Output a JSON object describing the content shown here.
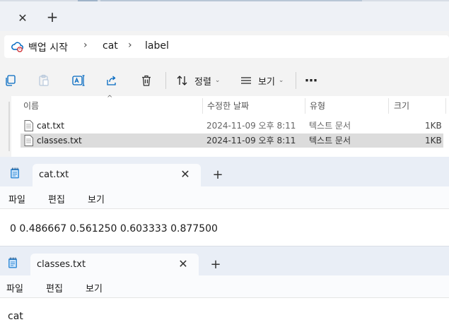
{
  "explorer": {
    "tab_close_glyph": "✕",
    "new_tab_glyph": "+",
    "breadcrumb": [
      "백업 시작",
      "cat",
      "label"
    ],
    "breadcrumb_sep": "›",
    "toolbar": {
      "sort_label": "정렬",
      "view_label": "보기",
      "more_glyph": "⋯",
      "chevron": "⌄"
    },
    "columns": [
      "이름",
      "수정한 날짜",
      "유형",
      "크기"
    ],
    "sort_caret": "^",
    "files": [
      {
        "name": "cat.txt",
        "modified": "2024-11-09 오후 8:11",
        "type": "텍스트 문서",
        "size": "1KB"
      },
      {
        "name": "classes.txt",
        "modified": "2024-11-09 오후 8:11",
        "type": "텍스트 문서",
        "size": "1KB"
      }
    ]
  },
  "notepads": [
    {
      "tab_title": "cat.txt",
      "close_glyph": "✕",
      "plus_glyph": "+",
      "menu": [
        "파일",
        "편집",
        "보기"
      ],
      "content": "0 0.486667 0.561250 0.603333 0.877500"
    },
    {
      "tab_title": "classes.txt",
      "close_glyph": "✕",
      "plus_glyph": "+",
      "menu": [
        "파일",
        "편집",
        "보기"
      ],
      "content": "cat"
    }
  ],
  "colors": {
    "accent": "#0067c0",
    "selection": "#dcdcdc",
    "tabstrip": "#eef1f6",
    "notepad_titlebar": "#e9eef6"
  }
}
